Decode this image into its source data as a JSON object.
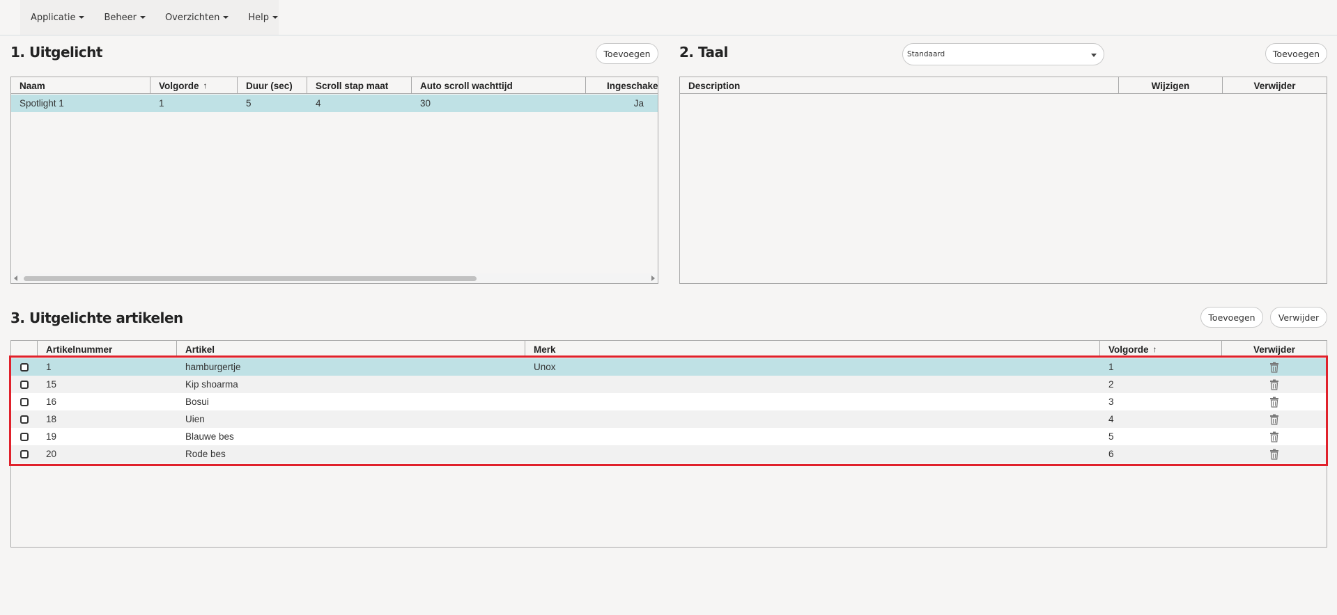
{
  "menu": {
    "items": [
      "Applicatie",
      "Beheer",
      "Overzichten",
      "Help"
    ]
  },
  "section1": {
    "title": "1. Uitgelicht",
    "add_label": "Toevoegen",
    "columns": [
      "Naam",
      "Volgorde",
      "Duur (sec)",
      "Scroll stap maat",
      "Auto scroll wachttijd",
      "Ingeschakeld"
    ],
    "sorted_column": "Volgorde",
    "rows": [
      {
        "naam": "Spotlight 1",
        "volgorde": "1",
        "duur": "5",
        "scroll_stap": "4",
        "wachttijd": "30",
        "ingeschakeld": "Ja"
      }
    ]
  },
  "section2": {
    "title": "2. Taal",
    "language_selected": "Standaard",
    "add_label": "Toevoegen",
    "columns": [
      "Description",
      "Wijzigen",
      "Verwijder"
    ]
  },
  "section3": {
    "title": "3. Uitgelichte artikelen",
    "add_label": "Toevoegen",
    "delete_label": "Verwijder",
    "columns": [
      "",
      "Artikelnummer",
      "Artikel",
      "Merk",
      "Volgorde",
      "Verwijder"
    ],
    "sorted_column": "Volgorde",
    "rows": [
      {
        "nummer": "1",
        "artikel": "hamburgertje",
        "merk": "Unox",
        "volgorde": "1"
      },
      {
        "nummer": "15",
        "artikel": "Kip shoarma",
        "merk": "",
        "volgorde": "2"
      },
      {
        "nummer": "16",
        "artikel": "Bosui",
        "merk": "",
        "volgorde": "3"
      },
      {
        "nummer": "18",
        "artikel": "Uien",
        "merk": "",
        "volgorde": "4"
      },
      {
        "nummer": "19",
        "artikel": "Blauwe bes",
        "merk": "",
        "volgorde": "5"
      },
      {
        "nummer": "20",
        "artikel": "Rode bes",
        "merk": "",
        "volgorde": "6"
      }
    ]
  },
  "colors": {
    "selected_row": "#bfe1e5",
    "highlight_border": "#e0212b"
  },
  "icons": {
    "sort": "arrow-up-icon",
    "delete": "trash-icon",
    "row_select": "checkbox-icon"
  }
}
